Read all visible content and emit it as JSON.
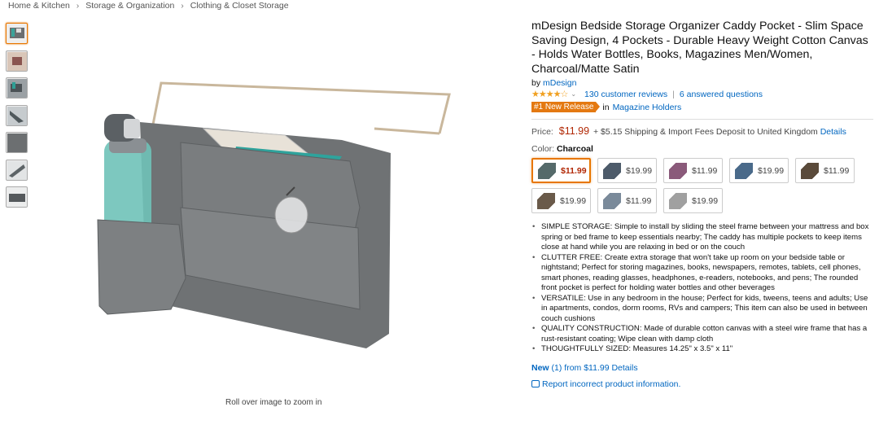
{
  "breadcrumb": [
    "Home & Kitchen",
    "Storage & Organization",
    "Clothing & Closet Storage"
  ],
  "breadcrumb_sep": "›",
  "image": {
    "zoom_hint": "Roll over image to zoom in"
  },
  "thumbnails": [
    "thumb-1",
    "thumb-2",
    "thumb-3",
    "thumb-4",
    "thumb-5",
    "thumb-6",
    "thumb-7"
  ],
  "product": {
    "title": "mDesign Bedside Storage Organizer Caddy Pocket - Slim Space Saving Design, 4 Pockets - Durable Heavy Weight Cotton Canvas - Holds Water Bottles, Books, Magazines Men/Women, Charcoal/Matte Satin",
    "by_label": "by",
    "brand": "mDesign",
    "stars": "★★★★☆",
    "stars_caret": "⌄",
    "reviews": "130 customer reviews",
    "pipe": "|",
    "questions": "6 answered questions",
    "badge": "#1 New Release",
    "in_label": "in",
    "category": "Magazine Holders",
    "price_label": "Price:",
    "price": "$11.99",
    "shipping": "+ $5.15 Shipping & Import Fees Deposit to United Kingdom",
    "details_link": "Details",
    "color_label": "Color:",
    "color_value": "Charcoal"
  },
  "swatches": [
    {
      "price": "$11.99",
      "selected": true,
      "color": "#556a6a"
    },
    {
      "price": "$19.99",
      "selected": false,
      "color": "#4d5b6a"
    },
    {
      "price": "$11.99",
      "selected": false,
      "color": "#8a5a7a"
    },
    {
      "price": "$19.99",
      "selected": false,
      "color": "#4a6a8a"
    },
    {
      "price": "$11.99",
      "selected": false,
      "color": "#5a4a3a"
    },
    {
      "price": "$19.99",
      "selected": false,
      "color": "#6a5a4a"
    },
    {
      "price": "$11.99",
      "selected": false,
      "color": "#7a8a9a"
    },
    {
      "price": "$19.99",
      "selected": false,
      "color": "#a0a0a0"
    }
  ],
  "bullets": [
    "SIMPLE STORAGE: Simple to install by sliding the steel frame between your mattress and box spring or bed frame to keep essentials nearby; The caddy has multiple pockets to keep items close at hand while you are relaxing in bed or on the couch",
    "CLUTTER FREE: Create extra storage that won't take up room on your bedside table or nightstand; Perfect for storing magazines, books, newspapers, remotes, tablets, cell phones, smart phones, reading glasses, headphones, e-readers, notebooks, and pens; The rounded front pocket is perfect for holding water bottles and other beverages",
    "VERSATILE: Use in any bedroom in the house; Perfect for kids, tweens, teens and adults; Use in apartments, condos, dorm rooms, RVs and campers; This item can also be used in between couch cushions",
    "QUALITY CONSTRUCTION: Made of durable cotton canvas with a steel wire frame that has a rust-resistant coating; Wipe clean with damp cloth",
    "THOUGHTFULLY SIZED: Measures 14.25\" x 3.5\" x 11\""
  ],
  "offers": {
    "new_label": "New",
    "count": "(1)",
    "from": "from $11.99",
    "details": "Details"
  },
  "report": "Report incorrect product information."
}
